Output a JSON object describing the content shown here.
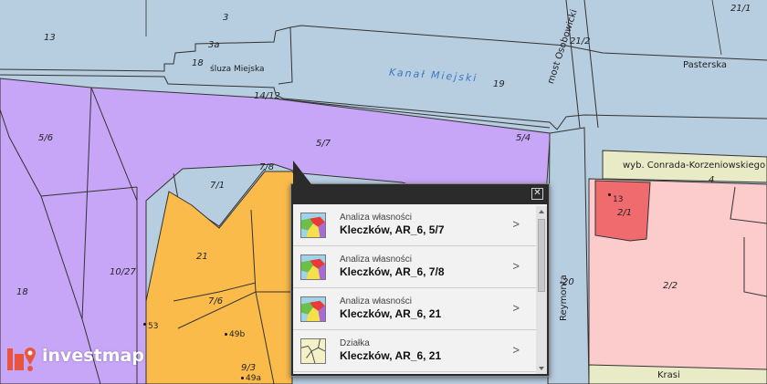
{
  "map": {
    "parcel_labels": [
      {
        "id": "p3",
        "text": "3"
      },
      {
        "id": "p13",
        "text": "13"
      },
      {
        "id": "p3a",
        "text": "3a"
      },
      {
        "id": "p18a",
        "text": "18"
      },
      {
        "id": "p1412",
        "text": "14/12"
      },
      {
        "id": "p19",
        "text": "19"
      },
      {
        "id": "p212",
        "text": "21/2"
      },
      {
        "id": "p211",
        "text": "21/1"
      },
      {
        "id": "p56",
        "text": "5/6"
      },
      {
        "id": "p57",
        "text": "5/7"
      },
      {
        "id": "p54",
        "text": "5/4"
      },
      {
        "id": "p78",
        "text": "7/8"
      },
      {
        "id": "p71",
        "text": "7/1"
      },
      {
        "id": "p21",
        "text": "21"
      },
      {
        "id": "p1027",
        "text": "10/27"
      },
      {
        "id": "p18b",
        "text": "18"
      },
      {
        "id": "p76",
        "text": "7/6"
      },
      {
        "id": "p53",
        "text": "53"
      },
      {
        "id": "p49b",
        "text": "49b"
      },
      {
        "id": "p93",
        "text": "9/3"
      },
      {
        "id": "p49a",
        "text": "49a"
      },
      {
        "id": "p20",
        "text": "20"
      },
      {
        "id": "p13b",
        "text": "13"
      },
      {
        "id": "p2_1",
        "text": "2/1"
      },
      {
        "id": "p2_2",
        "text": "2/2"
      },
      {
        "id": "p4",
        "text": "4"
      }
    ],
    "canal_name": "Kanał Miejski",
    "lock_name": "śluza Miejska",
    "bridge_name": "most Osobowicki",
    "streets": {
      "pasterska": "Pasterska",
      "conrada": "wyb. Conrada-Korzeniowskiego",
      "reymonta": "Reymonta",
      "krasinskiego": "Krasi"
    },
    "colors": {
      "water": "#b7cde0",
      "purple_parcel": "#c8a6f7",
      "orange_parcel": "#fbbb4b",
      "pink_parcel": "#fccbcb",
      "red_parcel": "#f06b6e",
      "street_band": "#e8ebc6"
    }
  },
  "popup": {
    "close_label": "✕",
    "items": [
      {
        "category": "Analiza własności",
        "name": "Kleczków, AR_6, 5/7",
        "icon": "ownership-map-icon"
      },
      {
        "category": "Analiza własności",
        "name": "Kleczków, AR_6, 7/8",
        "icon": "ownership-map-icon"
      },
      {
        "category": "Analiza własności",
        "name": "Kleczków, AR_6, 21",
        "icon": "ownership-map-icon"
      },
      {
        "category": "Działka",
        "name": "Kleczków, AR_6, 21",
        "icon": "parcel-map-icon"
      }
    ],
    "chevron": ">"
  },
  "logo": {
    "text": "investmap",
    "color": "#e8553e"
  }
}
